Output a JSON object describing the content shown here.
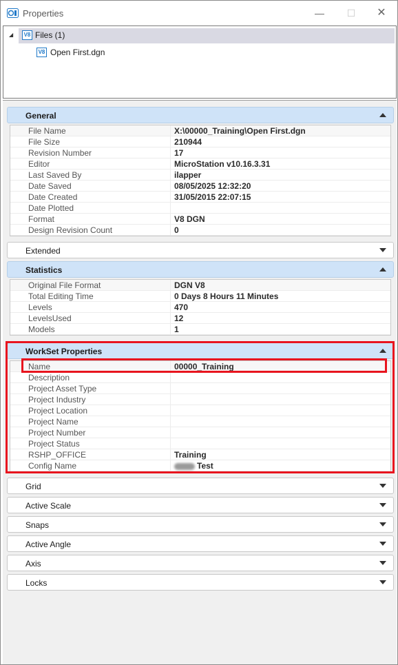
{
  "window": {
    "title": "Properties",
    "minimize_glyph": "—",
    "maximize_glyph": "☐",
    "close_glyph": "✕"
  },
  "tree": {
    "root_label": "Files (1)",
    "child_label": "Open First.dgn",
    "file_icon_text": "V8"
  },
  "sections": [
    {
      "title": "General",
      "expanded": true,
      "rows": [
        {
          "key": "File Name",
          "value": "X:\\00000_Training\\Open First.dgn"
        },
        {
          "key": "File Size",
          "value": "210944"
        },
        {
          "key": "Revision Number",
          "value": "17"
        },
        {
          "key": "Editor",
          "value": "MicroStation v10.16.3.31"
        },
        {
          "key": "Last Saved By",
          "value": "ilapper"
        },
        {
          "key": "Date Saved",
          "value": "08/05/2025 12:32:20"
        },
        {
          "key": "Date Created",
          "value": "31/05/2015 22:07:15"
        },
        {
          "key": "Date Plotted",
          "value": ""
        },
        {
          "key": "Format",
          "value": "V8 DGN"
        },
        {
          "key": "Design Revision Count",
          "value": "0"
        }
      ]
    },
    {
      "title": "Extended",
      "expanded": false
    },
    {
      "title": "Statistics",
      "expanded": true,
      "rows": [
        {
          "key": "Original File Format",
          "value": "DGN V8"
        },
        {
          "key": "Total Editing Time",
          "value": "0 Days 8 Hours 11 Minutes"
        },
        {
          "key": "Levels",
          "value": "470"
        },
        {
          "key": "LevelsUsed",
          "value": "12"
        },
        {
          "key": "Models",
          "value": "1"
        }
      ]
    },
    {
      "title": "WorkSet Properties",
      "expanded": true,
      "rows": [
        {
          "key": "Name",
          "value": "00000_Training"
        },
        {
          "key": "Description",
          "value": ""
        },
        {
          "key": "Project Asset Type",
          "value": ""
        },
        {
          "key": "Project Industry",
          "value": ""
        },
        {
          "key": "Project Location",
          "value": ""
        },
        {
          "key": "Project Name",
          "value": ""
        },
        {
          "key": "Project Number",
          "value": ""
        },
        {
          "key": "Project Status",
          "value": ""
        },
        {
          "key": "RSHP_OFFICE",
          "value": "Training"
        },
        {
          "key": "Config Name",
          "value": "Test"
        }
      ]
    },
    {
      "title": "Grid",
      "expanded": false
    },
    {
      "title": "Active Scale",
      "expanded": false
    },
    {
      "title": "Snaps",
      "expanded": false
    },
    {
      "title": "Active Angle",
      "expanded": false
    },
    {
      "title": "Axis",
      "expanded": false
    },
    {
      "title": "Locks",
      "expanded": false
    }
  ],
  "colors": {
    "header_open": "#cfe3f8",
    "highlight": "#e8141e",
    "icon_blue": "#1e78c8"
  }
}
